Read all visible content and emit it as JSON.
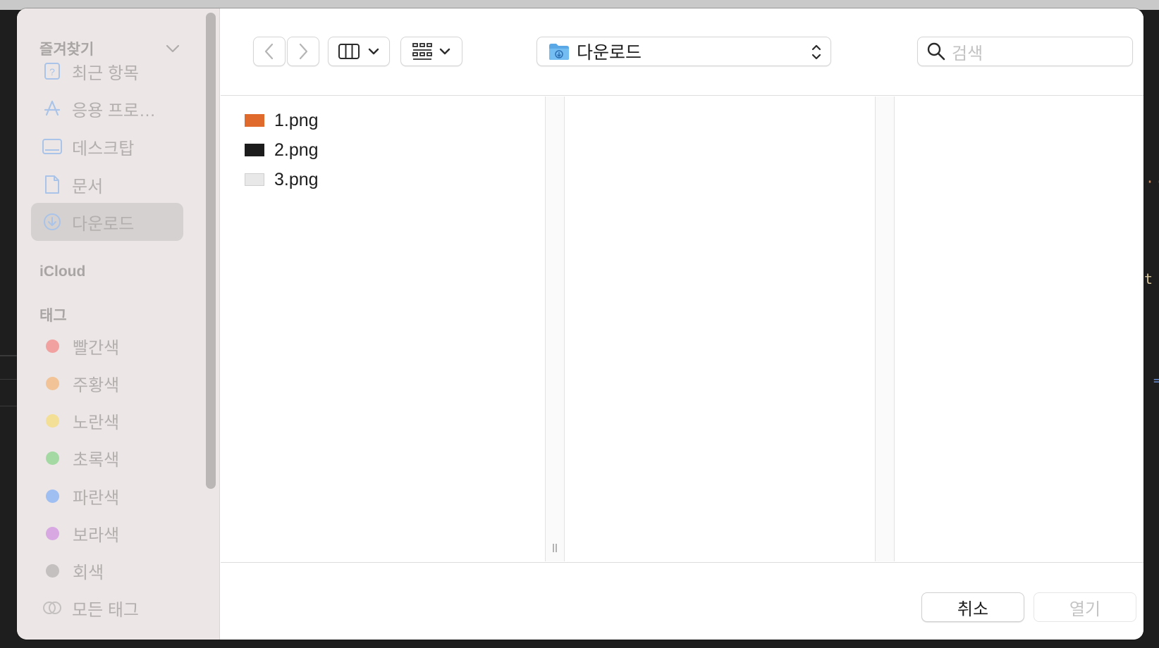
{
  "sidebar": {
    "favorites_title": "즐겨찾기",
    "favorites": [
      {
        "label": "최근 항목",
        "icon": "recents-icon"
      },
      {
        "label": "응용 프로…",
        "icon": "applications-icon"
      },
      {
        "label": "데스크탑",
        "icon": "desktop-icon"
      },
      {
        "label": "문서",
        "icon": "document-icon"
      },
      {
        "label": "다운로드",
        "icon": "downloads-icon",
        "selected": true
      }
    ],
    "icloud_title": "iCloud",
    "tags_title": "태그",
    "tags": [
      {
        "label": "빨간색",
        "color": "#f2a1a1"
      },
      {
        "label": "주황색",
        "color": "#f2c396"
      },
      {
        "label": "노란색",
        "color": "#f3df96"
      },
      {
        "label": "초록색",
        "color": "#a4d9a4"
      },
      {
        "label": "파란색",
        "color": "#9fbef2"
      },
      {
        "label": "보라색",
        "color": "#d8a8e3"
      },
      {
        "label": "회색",
        "color": "#c3c0bf"
      },
      {
        "label": "모든 태그",
        "icon": "all-tags-icon"
      }
    ]
  },
  "toolbar": {
    "location": "다운로드",
    "search_placeholder": "검색"
  },
  "files": [
    {
      "name": "1.png",
      "thumb_color": "#e06a2c"
    },
    {
      "name": "2.png",
      "thumb_color": "#1c1c1c"
    },
    {
      "name": "3.png",
      "thumb_color": "#e8e8e8"
    }
  ],
  "footer": {
    "cancel_label": "취소",
    "open_label": "열기"
  }
}
